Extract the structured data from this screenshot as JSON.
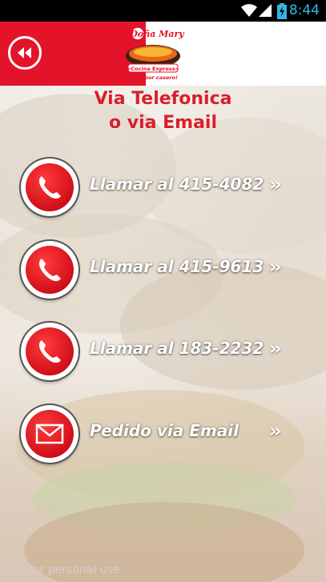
{
  "status_bar": {
    "time": "8:44"
  },
  "header": {
    "logo_text": "Doña Mary",
    "logo_subtitle": "«Cocina Express»",
    "logo_tagline": "¡El sabor casero!"
  },
  "content": {
    "title_line1": "Via Telefonica",
    "title_line2": "o via Email",
    "actions": [
      {
        "label": "Llamar al 415-4082",
        "icon": "phone-icon"
      },
      {
        "label": "Llamar al 415-9613",
        "icon": "phone-icon"
      },
      {
        "label": "Llamar al 183-2232",
        "icon": "phone-icon"
      },
      {
        "label": "Pedido via Email",
        "icon": "envelope-icon"
      }
    ],
    "chevron": "»"
  },
  "watermark": "free for personal use",
  "colors": {
    "brand_red": "#e3132a",
    "title_red": "#d81f2a",
    "status_blue": "#33b5e5"
  }
}
